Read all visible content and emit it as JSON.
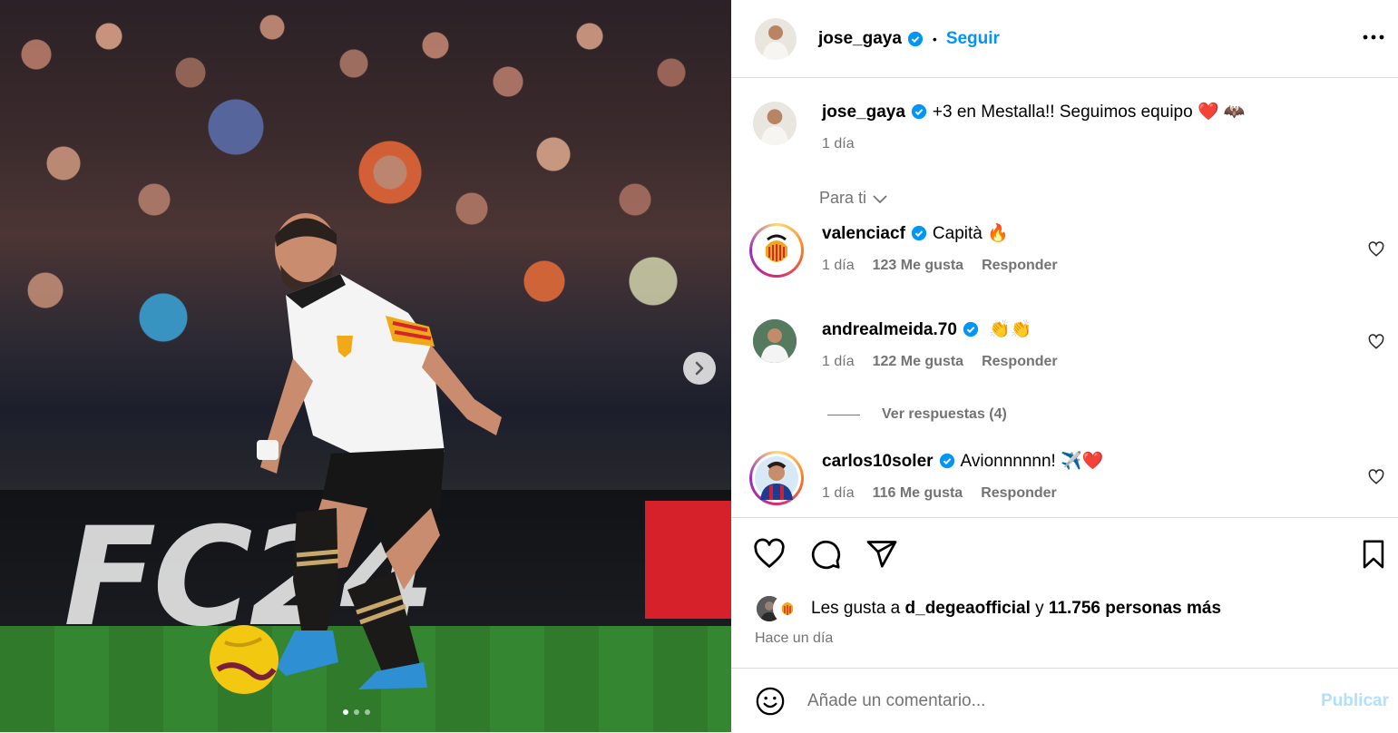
{
  "post": {
    "author": "jose_gaya",
    "follow_label": "Seguir",
    "separator": "•",
    "caption": "+3 en Mestalla!! Seguimos equipo",
    "caption_emoji": "❤️ 🦇",
    "caption_time": "1 día",
    "board_text": "FC24"
  },
  "sort_label": "Para ti",
  "comments": [
    {
      "user": "valenciacf",
      "text": "Capità",
      "emoji": "🔥",
      "time": "1 día",
      "likes": "123 Me gusta",
      "reply": "Responder"
    },
    {
      "user": "andrealmeida.70",
      "text": "",
      "emoji": "👏👏",
      "time": "1 día",
      "likes": "122 Me gusta",
      "reply": "Responder"
    },
    {
      "user": "carlos10soler",
      "text": "Avionnnnnn!",
      "emoji": "✈️❤️",
      "time": "1 día",
      "likes": "116 Me gusta",
      "reply": "Responder"
    }
  ],
  "view_replies": "Ver respuestas (4)",
  "likes": {
    "prefix": "Les gusta a",
    "user": "d_degeaofficial",
    "joiner": "y",
    "others": "11.756 personas más"
  },
  "post_time": "Hace un día",
  "composer": {
    "placeholder": "Añade un comentario...",
    "publish": "Publicar"
  },
  "carousel": {
    "current": 1,
    "total": 3
  },
  "colors": {
    "link": "#0095f6",
    "muted": "#737373",
    "publish_disabled": "#b2dffc",
    "verified": "#0095f6"
  }
}
